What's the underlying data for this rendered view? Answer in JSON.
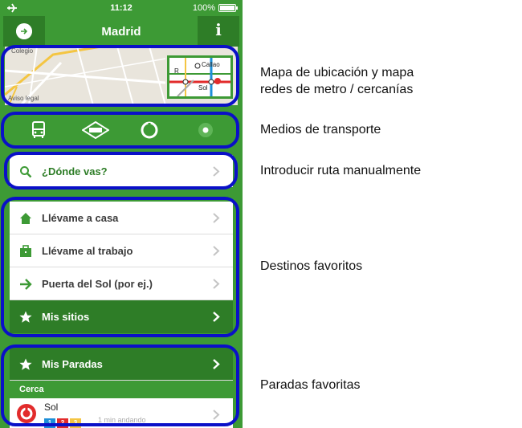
{
  "status_bar": {
    "time": "11:12",
    "battery": "100%"
  },
  "nav_bar": {
    "title": "Madrid",
    "info_label": "i"
  },
  "map": {
    "street_label": "Colegio",
    "legal_label": "Aviso legal",
    "metro_labels": {
      "callao": "Callao",
      "sol": "Sol",
      "r": "R"
    }
  },
  "transport_modes": [
    "bus-icon",
    "cercanias-icon",
    "metro-icon",
    "location-dot-icon"
  ],
  "search": {
    "label": "¿Dónde vas?"
  },
  "favorites": {
    "items": [
      {
        "label": "Llévame a casa",
        "icon": "home-icon"
      },
      {
        "label": "Llévame al trabajo",
        "icon": "briefcase-icon"
      },
      {
        "label": "Puerta del Sol (por ej.)",
        "icon": "arrow-right-icon"
      },
      {
        "label": "Mis sitios",
        "icon": "star-icon"
      }
    ]
  },
  "stops": {
    "header": "Mis Paradas",
    "section": "Cerca",
    "stop_name": "Sol",
    "stop_badges": [
      "1",
      "2",
      "3"
    ],
    "stop_time": "1 min andando"
  },
  "annotations": {
    "map": [
      "Mapa de ubicación y mapa",
      "redes de metro / cercanías"
    ],
    "transport": "Medios de transporte",
    "route": "Introducir ruta manualmente",
    "favorites": "Destinos favoritos",
    "stops": "Paradas favoritas"
  },
  "colors": {
    "app_green": "#3d9a35",
    "dark_green": "#2e7d27",
    "outline_blue": "#0a10c8"
  }
}
